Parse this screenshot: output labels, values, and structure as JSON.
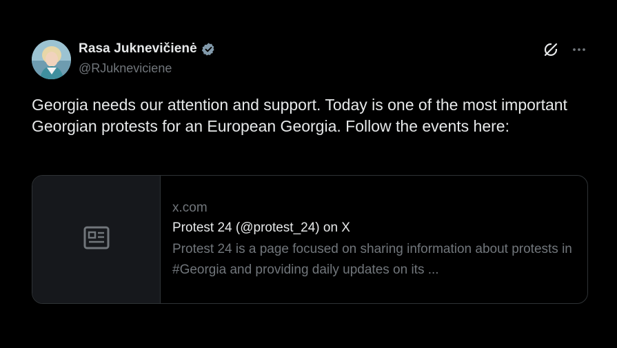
{
  "author": {
    "display_name": "Rasa Juknevičienė",
    "handle": "@RJukneviciene",
    "verified": true,
    "verified_color": "#829aab"
  },
  "actions": {
    "grok_icon": "grok-icon",
    "more_icon": "more-icon"
  },
  "tweet": {
    "text": "Georgia needs our attention and support. Today is one of the most important Georgian protests for an European Georgia. Follow the events here:"
  },
  "link_card": {
    "domain": "x.com",
    "title": "Protest 24 (@protest_24) on X",
    "description": "Protest 24 is a page focused on sharing information about protests in #Georgia and providing daily updates on its ...",
    "thumb_icon": "article-icon"
  },
  "colors": {
    "background": "#000000",
    "primary_text": "#e7e9ea",
    "secondary_text": "#71767b",
    "border": "#2f3336"
  }
}
